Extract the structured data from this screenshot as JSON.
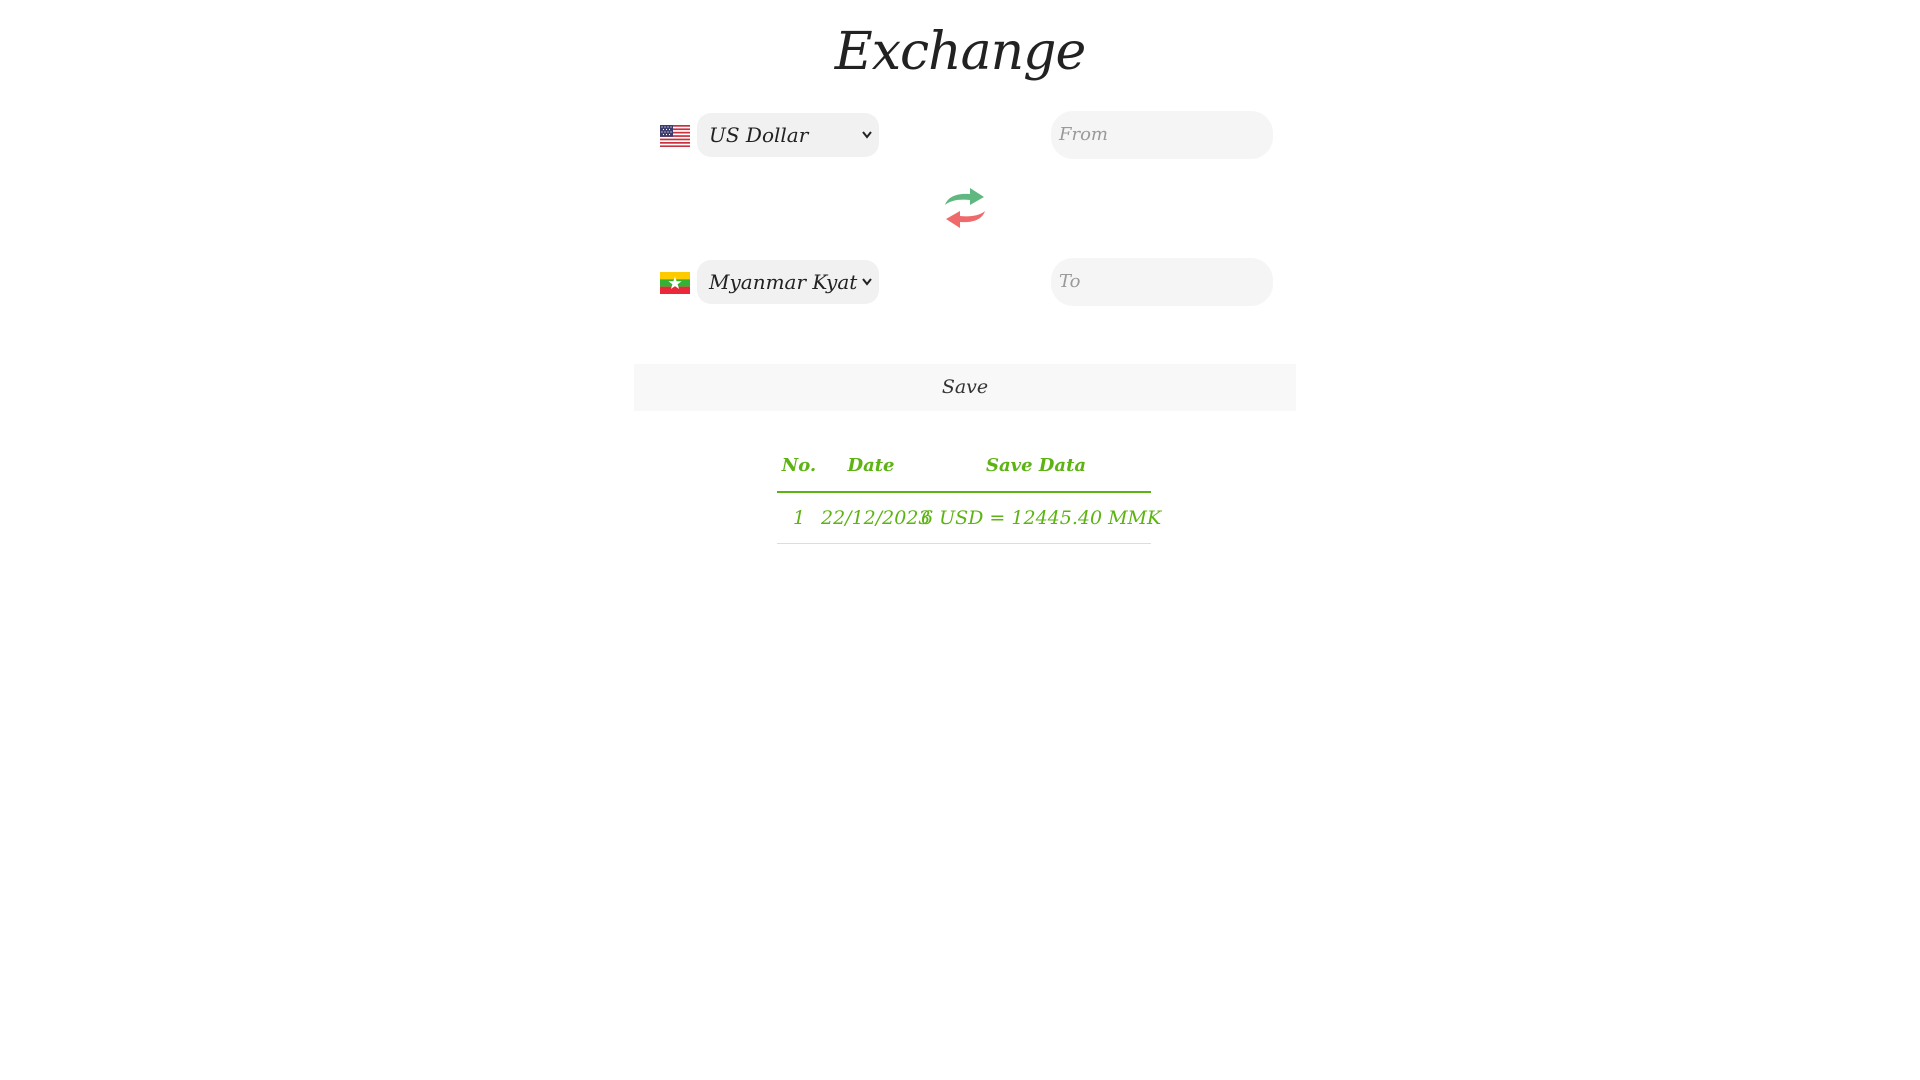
{
  "page": {
    "title": "Exchange"
  },
  "from": {
    "flag_icon": "us-flag-icon",
    "currency": "US Dollar",
    "placeholder": "From"
  },
  "swap": {
    "icon": "swap-arrows-icon",
    "colors": {
      "top_arrow": "#5fb87f",
      "bottom_arrow": "#ef6b6b"
    }
  },
  "to": {
    "flag_icon": "myanmar-flag-icon",
    "currency": "Myanmar Kyat",
    "placeholder": "To"
  },
  "save_button": {
    "label": "Save"
  },
  "history_table": {
    "headers": [
      "No.",
      "Date",
      "Save Data"
    ],
    "rows": [
      {
        "no": "1",
        "date": "22/12/2023",
        "data": "6 USD = 12445.40 MMK"
      }
    ],
    "accent_color": "#5cb312"
  }
}
